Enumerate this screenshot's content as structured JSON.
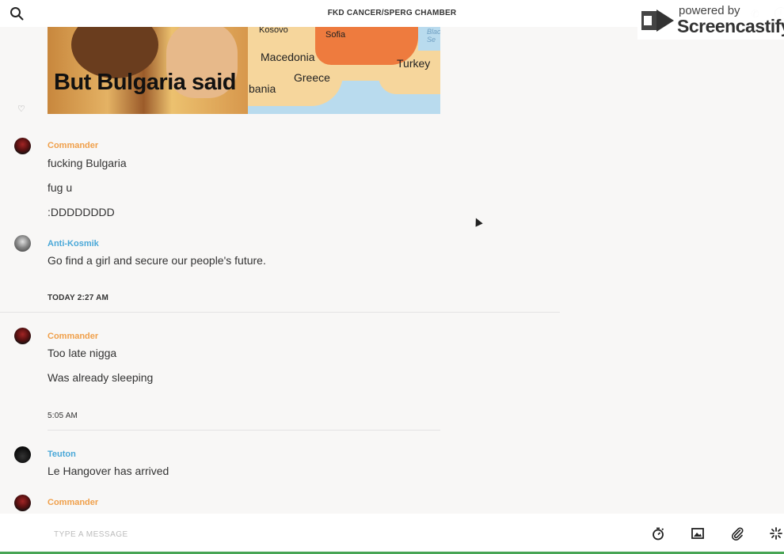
{
  "header": {
    "title": "FKD CANCER/SPERG CHAMBER",
    "watermark_small": "powered by",
    "watermark_big": "Screencastify"
  },
  "meme": {
    "caption": "But Bulgaria said",
    "map_labels": {
      "kosovo": "Kosovo",
      "sofia": "Sofia",
      "macedonia": "Macedonia",
      "turkey": "Turkey",
      "greece": "Greece",
      "albania": "bania",
      "sea": "Blac Se"
    }
  },
  "messages": [
    {
      "author": "Commander",
      "author_color": "#f0a04b",
      "lines": [
        "fucking Bulgaria",
        "fug u",
        ":DDDDDDDD"
      ]
    },
    {
      "author": "Anti-Kosmik",
      "author_color": "#4aa8d8",
      "lines": [
        "Go find a girl and secure our people's future."
      ]
    },
    {
      "timestamp": "TODAY 2:27 AM"
    },
    {
      "author": "Commander",
      "author_color": "#f0a04b",
      "lines": [
        "Too late nigga",
        "Was already sleeping"
      ]
    },
    {
      "timestamp": "5:05 AM"
    },
    {
      "author": "Teuton",
      "author_color": "#4aa8d8",
      "lines": [
        "Le Hangover has arrived"
      ]
    },
    {
      "author": "Commander",
      "author_color": "#f0a04b",
      "lines": []
    }
  ],
  "composer": {
    "placeholder": "TYPE A MESSAGE"
  },
  "icons": {
    "search": "search-icon",
    "like": "heart-icon",
    "timer": "stopwatch-icon",
    "image": "image-icon",
    "attach": "paperclip-icon",
    "more": "sparkle-icon",
    "phone": "phone-icon",
    "info": "info-icon"
  }
}
